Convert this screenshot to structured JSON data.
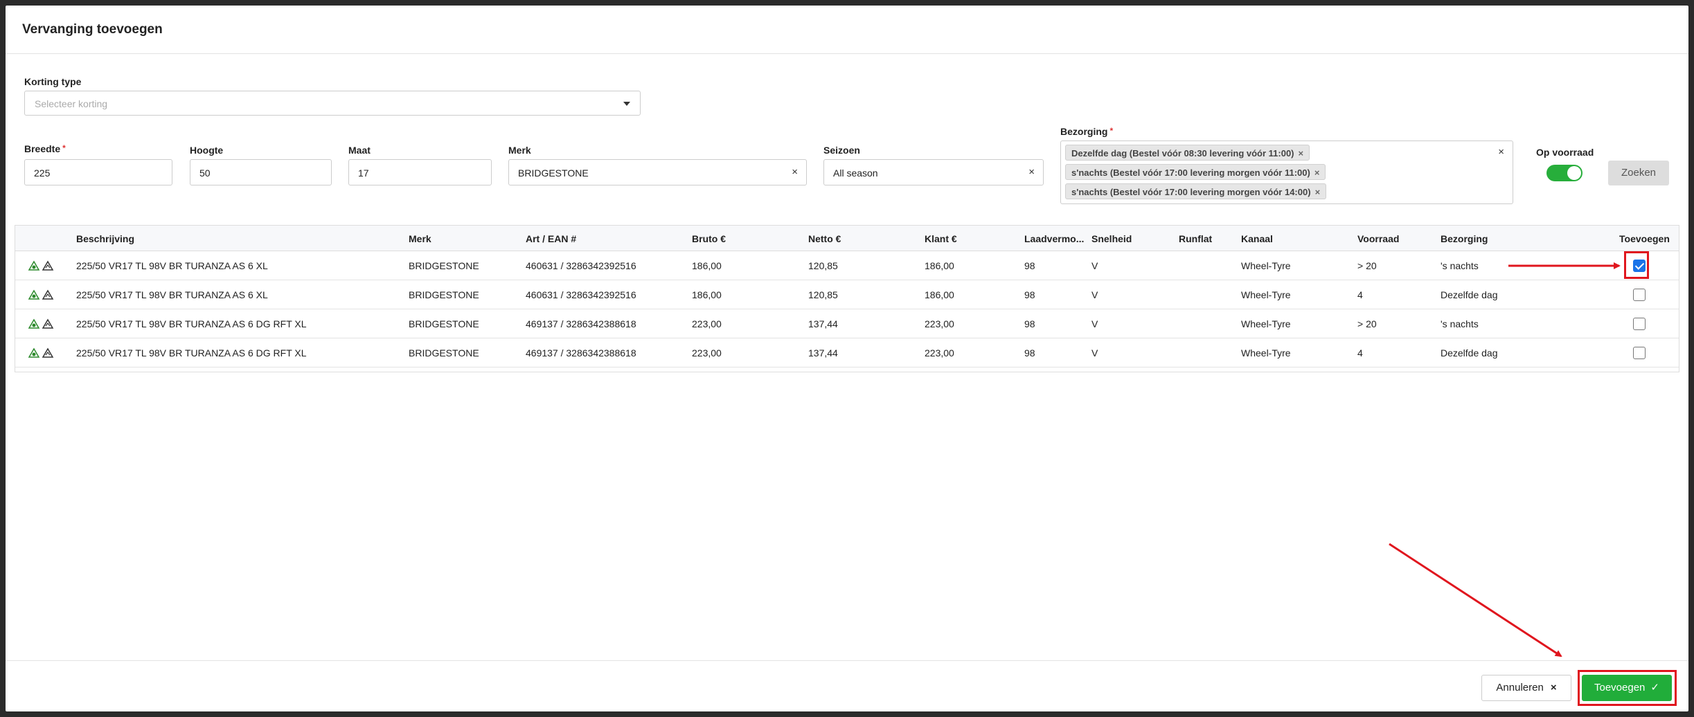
{
  "modal": {
    "title": "Vervanging toevoegen"
  },
  "form": {
    "korting_label": "Korting type",
    "korting_placeholder": "Selecteer korting",
    "breedte_label": "Breedte",
    "breedte_value": "225",
    "hoogte_label": "Hoogte",
    "hoogte_value": "50",
    "maat_label": "Maat",
    "maat_value": "17",
    "merk_label": "Merk",
    "merk_value": "BRIDGESTONE",
    "seizoen_label": "Seizoen",
    "seizoen_value": "All season",
    "bezorging_label": "Bezorging",
    "bezorging_tags": [
      "Dezelfde dag (Bestel vóór 08:30 levering vóór 11:00)",
      "s'nachts (Bestel vóór 17:00 levering morgen vóór 11:00)",
      "s'nachts (Bestel vóór 17:00 levering morgen vóór 14:00)"
    ],
    "op_voorraad_label": "Op voorraad",
    "op_voorraad_on": true,
    "zoeken_label": "Zoeken",
    "required_mark": "*",
    "clear_glyph": "×"
  },
  "table": {
    "headers": [
      "Beschrijving",
      "Merk",
      "Art / EAN #",
      "Bruto €",
      "Netto €",
      "Klant €",
      "Laadvermo...",
      "Snelheid",
      "Runflat",
      "Kanaal",
      "Voorraad",
      "Bezorging",
      "Toevoegen"
    ],
    "rows": [
      [
        "225/50 VR17 TL 98V BR TURANZA AS 6 XL",
        "BRIDGESTONE",
        "460631 / 3286342392516",
        "186,00",
        "120,85",
        "186,00",
        "98",
        "V",
        "",
        "Wheel-Tyre",
        "> 20",
        "'s nachts"
      ],
      [
        "225/50 VR17 TL 98V BR TURANZA AS 6 XL",
        "BRIDGESTONE",
        "460631 / 3286342392516",
        "186,00",
        "120,85",
        "186,00",
        "98",
        "V",
        "",
        "Wheel-Tyre",
        "4",
        "Dezelfde dag"
      ],
      [
        "225/50 VR17 TL 98V BR TURANZA AS 6 DG RFT XL",
        "BRIDGESTONE",
        "469137 / 3286342388618",
        "223,00",
        "137,44",
        "223,00",
        "98",
        "V",
        "",
        "Wheel-Tyre",
        "> 20",
        "'s nachts"
      ],
      [
        "225/50 VR17 TL 98V BR TURANZA AS 6 DG RFT XL",
        "BRIDGESTONE",
        "469137 / 3286342388618",
        "223,00",
        "137,44",
        "223,00",
        "98",
        "V",
        "",
        "Wheel-Tyre",
        "4",
        "Dezelfde dag"
      ]
    ],
    "checked": [
      true,
      false,
      false,
      false
    ]
  },
  "footer": {
    "annuleren_label": "Annuleren",
    "annuleren_icon": "×",
    "toevoegen_label": "Toevoegen",
    "toevoegen_icon": "✓"
  },
  "colors": {
    "accent_green": "#21ad3a",
    "annotation_red": "#e0161e",
    "checkbox_blue": "#1a73e8"
  }
}
